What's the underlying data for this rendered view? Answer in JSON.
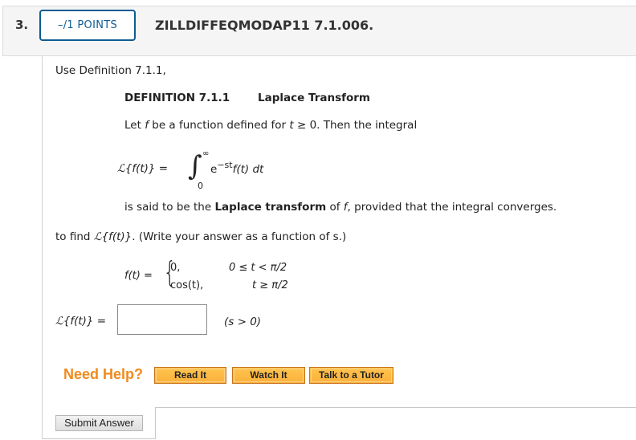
{
  "question": {
    "number": "3.",
    "points": "–/1 POINTS",
    "id": "ZILLDIFFEQMODAP11 7.1.006."
  },
  "prompt": {
    "intro": "Use Definition 7.1.1,",
    "definition_label": "DEFINITION 7.1.1",
    "definition_title": "Laplace Transform",
    "let_pre": "Let ",
    "let_f": "f",
    "let_mid": " be a function defined for ",
    "let_t": "t",
    "let_post": " ≥ 0. Then the integral",
    "integral_lhs_L": "ℒ",
    "integral_lhs_rest": "{f(t)} =",
    "integral_sign": "∫",
    "integral_upper": "∞",
    "integral_lower": "0",
    "integrand_e": "e",
    "integrand_exp": "−st",
    "integrand_rest": "f(t) dt",
    "said_pre": "is said to be the ",
    "said_bold": "Laplace transform",
    "said_mid": " of ",
    "said_f": "f",
    "said_post": ", provided that the integral converges.",
    "find_pre": "to find ",
    "find_L": "ℒ",
    "find_expr": "{f(t)}",
    "find_post": ". (Write your answer as a function of s.)"
  },
  "piecewise": {
    "lhs": "f(t) =",
    "brace": "{",
    "cases": [
      {
        "value": "0,",
        "condition": "0 ≤ t < π/2"
      },
      {
        "value": "cos(t),",
        "condition": "t ≥ π/2"
      }
    ]
  },
  "answer": {
    "lhs_L": "ℒ",
    "lhs_rest": "{f(t)} =",
    "value": "",
    "condition": "(s > 0)"
  },
  "help": {
    "label": "Need Help?",
    "buttons": [
      "Read It",
      "Watch It",
      "Talk to a Tutor"
    ]
  },
  "submit_label": "Submit Answer",
  "colors": {
    "points_border": "#0d5c91",
    "need_help": "#f08a1c",
    "help_button": "#fbb03b"
  }
}
